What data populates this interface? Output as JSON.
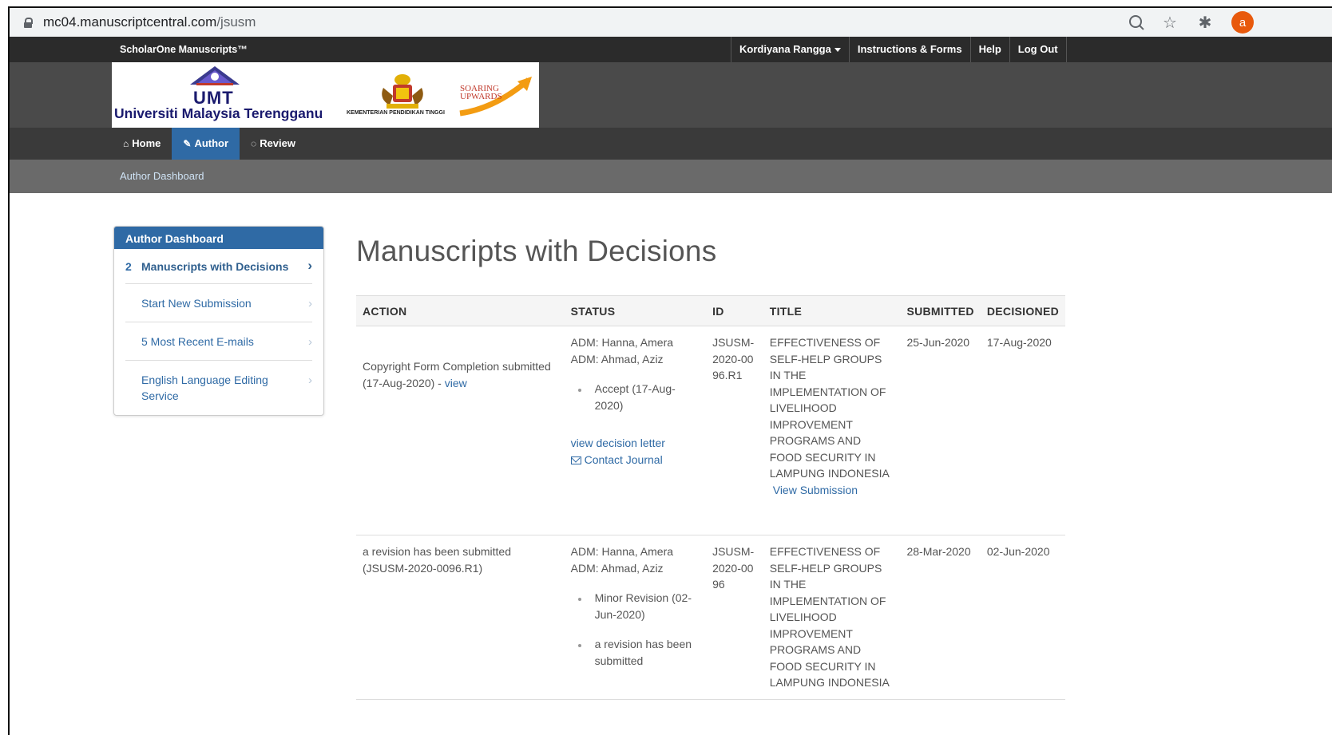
{
  "browser": {
    "url_host": "mc04.manuscriptcentral.com",
    "url_path": "/jsusm",
    "avatar_letter": "a"
  },
  "topbar": {
    "brand": "ScholarOne Manuscripts™",
    "user_menu": "Kordiyana Rangga",
    "links": [
      "Instructions & Forms",
      "Help",
      "Log Out"
    ]
  },
  "banner": {
    "logo_word": "UMT",
    "logo_full": "Universiti Malaysia Terengganu",
    "ministry": "KEMENTERIAN PENDIDIKAN TINGGI",
    "slogan_line1": "SOARING",
    "slogan_line2": "UPWARDS"
  },
  "mainnav": {
    "tabs": [
      {
        "label": "Home",
        "icon": "home-icon"
      },
      {
        "label": "Author",
        "icon": "pencil-icon"
      },
      {
        "label": "Review",
        "icon": "chat-icon"
      }
    ],
    "breadcrumb": "Author Dashboard"
  },
  "sidebar": {
    "title": "Author Dashboard",
    "items": [
      {
        "count": "2",
        "label": "Manuscripts with Decisions"
      },
      {
        "label": "Start New Submission"
      },
      {
        "label": "5 Most Recent E-mails"
      },
      {
        "label": "English Language Editing Service"
      }
    ]
  },
  "main": {
    "title": "Manuscripts with Decisions",
    "columns": [
      "ACTION",
      "STATUS",
      "ID",
      "TITLE",
      "SUBMITTED",
      "DECISIONED"
    ],
    "rows": [
      {
        "action_text": "Copyright Form Completion submitted (17-Aug-2020) - ",
        "action_link": "view",
        "adm1": "ADM: Hanna, Amera",
        "adm2": "ADM: Ahmad, Aziz",
        "status_bullets": [
          "Accept (17-Aug-2020)"
        ],
        "decision_letter": "view decision letter",
        "contact": "Contact Journal",
        "id": "JSUSM-2020-0096.R1",
        "title": "EFFECTIVENESS OF SELF-HELP GROUPS IN THE IMPLEMENTATION OF LIVELIHOOD IMPROVEMENT PROGRAMS AND FOOD SECURITY IN LAMPUNG INDONESIA",
        "view_submission": "View Submission",
        "submitted": "25-Jun-2020",
        "decisioned": "17-Aug-2020"
      },
      {
        "action_text": "a revision has been submitted (JSUSM-2020-0096.R1)",
        "adm1": "ADM: Hanna, Amera",
        "adm2": "ADM: Ahmad, Aziz",
        "status_bullets": [
          "Minor Revision (02-Jun-2020)",
          "a revision has been submitted"
        ],
        "id": "JSUSM-2020-0096",
        "title": "EFFECTIVENESS OF SELF-HELP GROUPS IN THE IMPLEMENTATION OF LIVELIHOOD IMPROVEMENT PROGRAMS AND FOOD SECURITY IN LAMPUNG INDONESIA",
        "submitted": "28-Mar-2020",
        "decisioned": "02-Jun-2020"
      }
    ]
  },
  "colors": {
    "accent": "#2f6aa5",
    "topbar": "#2b2b2b",
    "banner": "#4a4a4a"
  }
}
